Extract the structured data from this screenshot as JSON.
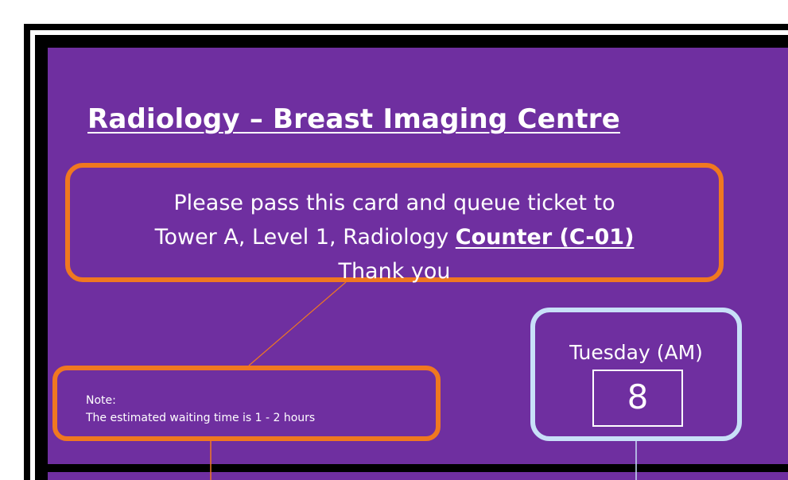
{
  "card": {
    "title": "Radiology – Breast Imaging Centre",
    "instruction": {
      "line1": "Please pass this card and queue ticket to",
      "line2_prefix": "Tower A, Level 1, Radiology ",
      "line2_counter": "Counter (C-01)",
      "line3": "Thank you"
    },
    "note": {
      "heading": "Note:",
      "text": "The estimated waiting time is 1 - 2 hours"
    },
    "schedule": {
      "day": "Tuesday (AM)",
      "number": "8"
    }
  },
  "colors": {
    "background": "#6f2fa0",
    "accent_orange": "#f07820",
    "accent_blue": "#c8e0f8",
    "text": "#ffffff"
  }
}
